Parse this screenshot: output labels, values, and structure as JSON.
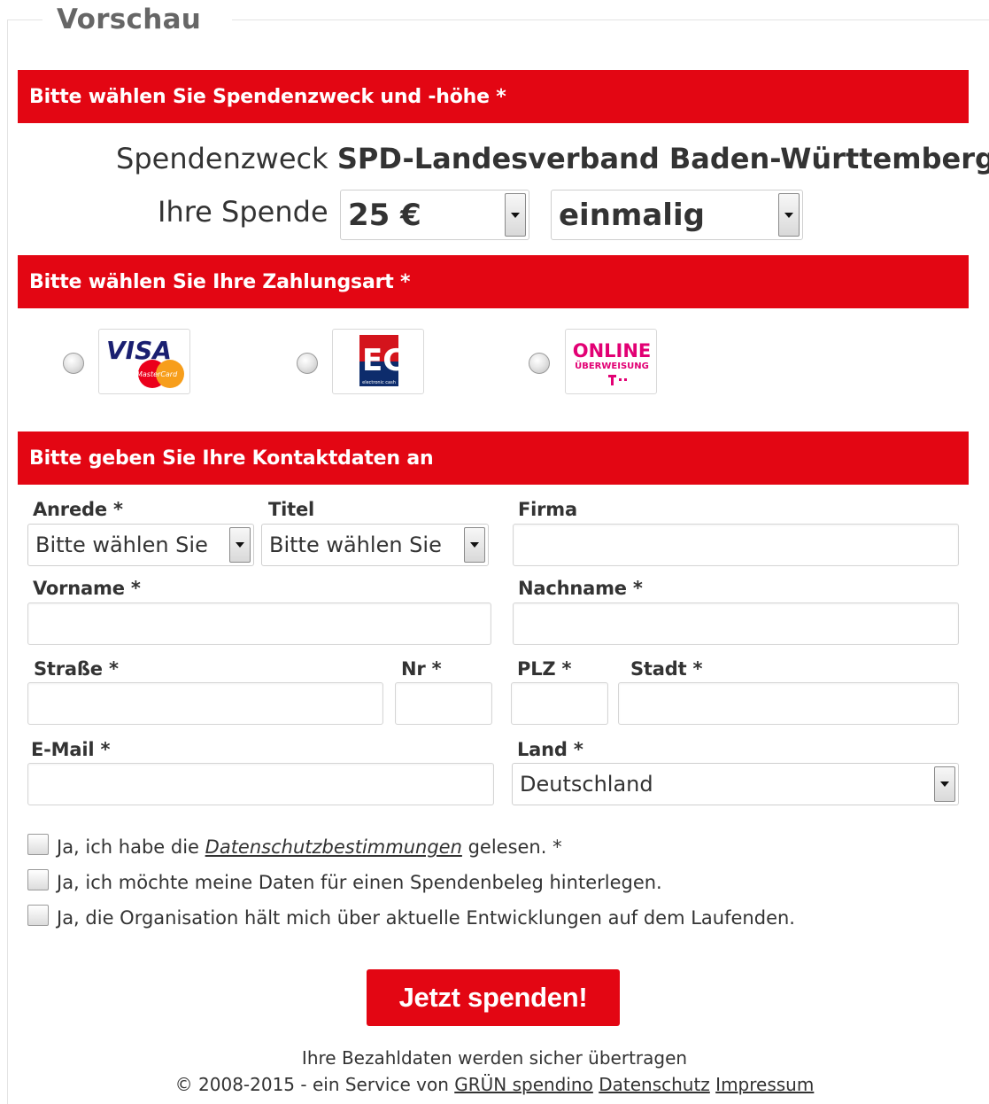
{
  "preview_title": "Vorschau",
  "section1": {
    "heading": "Bitte wählen Sie Spendenzweck und -höhe *",
    "purpose_label": "Spendenzweck",
    "purpose_value": "SPD-Landesverband Baden-Württemberg",
    "amount_label": "Ihre Spende",
    "amount_value": "25 €",
    "frequency_value": "einmalig"
  },
  "section2": {
    "heading": "Bitte wählen Sie Ihre Zahlungsart *",
    "methods": [
      {
        "logo_text": "VISA",
        "logo_subtext": "MasterCard",
        "icon": "visa-mastercard-logo"
      },
      {
        "logo_text": "EC",
        "logo_subtext": "electronic cash",
        "icon": "ec-card-logo"
      },
      {
        "logo_text": "ONLINE",
        "logo_subtext": "ÜBERWEISUNG",
        "icon": "online-ueberweisung-logo"
      }
    ]
  },
  "section3": {
    "heading": "Bitte geben Sie Ihre Kontaktdaten an",
    "fields": {
      "anrede_label": "Anrede",
      "anrede_value": "Bitte wählen Sie",
      "titel_label": "Titel",
      "titel_value": "Bitte wählen Sie",
      "firma_label": "Firma",
      "vorname_label": "Vorname",
      "nachname_label": "Nachname",
      "strasse_label": "Straße",
      "nr_label": "Nr",
      "plz_label": "PLZ",
      "stadt_label": "Stadt",
      "email_label": "E-Mail",
      "land_label": "Land",
      "land_value": "Deutschland"
    },
    "required_marker": "*"
  },
  "consents": {
    "privacy_prefix": "Ja, ich habe die",
    "privacy_link": "Datenschutzbestimmungen",
    "privacy_suffix": "gelesen. *",
    "receipt": "Ja, ich möchte meine Daten für einen Spendenbeleg hinterlegen.",
    "newsletter": "Ja, die Organisation hält mich über aktuelle Entwicklungen auf dem Laufenden."
  },
  "submit_label": "Jetzt spenden!",
  "footer": {
    "secure_note": "Ihre Bezahldaten werden sicher übertragen",
    "copyright": "© 2008-2015 - ein Service von",
    "link_spendino": "GRÜN spendino",
    "link_privacy": "Datenschutz",
    "link_imprint": "Impressum"
  },
  "colors": {
    "accent_red": "#e30613",
    "telekom_magenta": "#e20074"
  }
}
